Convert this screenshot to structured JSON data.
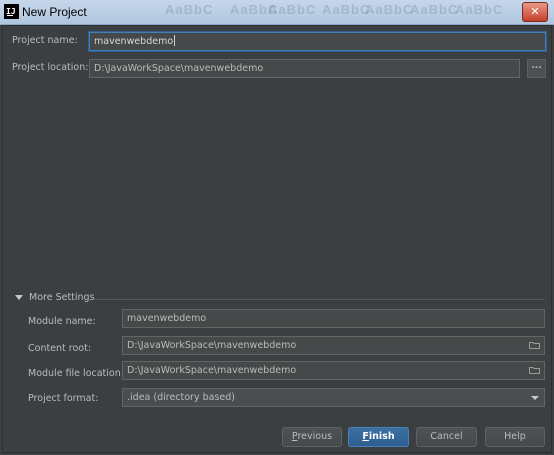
{
  "window": {
    "title": "New Project",
    "app_icon": "intellij-icon",
    "close_icon": "close-icon",
    "close_glyph": "✕"
  },
  "project": {
    "name_label": "Project name:",
    "name_value": "mavenwebdemo",
    "location_label": "Project location:",
    "location_value": "D:\\JavaWorkSpace\\mavenwebdemo",
    "browse_label": "..."
  },
  "more_settings": {
    "header": "More Settings",
    "expanded": true,
    "module_name_label": "Module name:",
    "module_name_value": "mavenwebdemo",
    "content_root_label": "Content root:",
    "content_root_value": "D:\\JavaWorkSpace\\mavenwebdemo",
    "module_file_location_label": "Module file location:",
    "module_file_location_value": "D:\\JavaWorkSpace\\mavenwebdemo",
    "project_format_label": "Project format:",
    "project_format_value": ".idea (directory based)"
  },
  "buttons": {
    "previous": {
      "mnemonic": "P",
      "rest": "revious"
    },
    "finish": {
      "mnemonic": "F",
      "rest": "inish"
    },
    "cancel": "Cancel",
    "help": "Help"
  },
  "colors": {
    "background": "#3c3f41",
    "field_bg": "#45494a",
    "focus_border": "#3d7fbf",
    "primary_button": "#365f8a",
    "text": "#bbbbbb"
  }
}
